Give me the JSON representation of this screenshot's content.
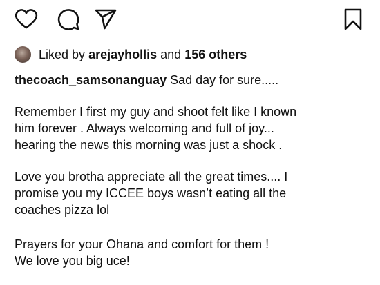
{
  "actions": {
    "like_icon": "heart-outline",
    "comment_icon": "speech-bubble",
    "share_icon": "paper-plane",
    "save_icon": "bookmark-outline"
  },
  "likes": {
    "prefix": "Liked by",
    "user": "arejayhollis",
    "conjunction": "and",
    "others": "156 others"
  },
  "caption": {
    "username": "thecoach_samsonanguay",
    "first_line_text": "Sad day for sure.....",
    "paragraph_1": [
      "Remember I first my guy and shoot felt like I known",
      "him forever . Always welcoming and full of joy...",
      "hearing the news this morning was just a shock ."
    ],
    "paragraph_2": [
      "Love you brotha appreciate all the great times.... I",
      "promise you my ICCEE boys wasn’t eating all the",
      "coaches pizza lol"
    ],
    "paragraph_3": [
      "Prayers for your Ohana and comfort for them !",
      "We love you big uce!"
    ]
  }
}
